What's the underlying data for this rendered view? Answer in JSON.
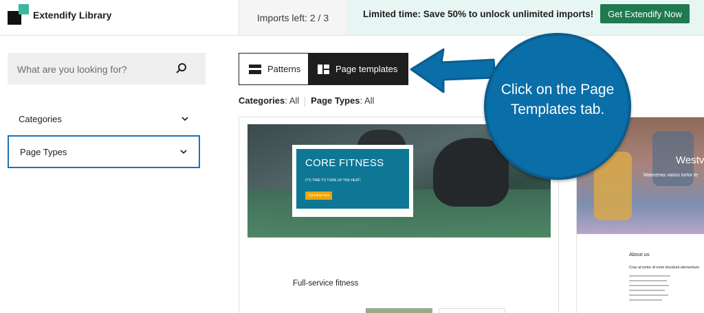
{
  "header": {
    "brand": "Extendify Library",
    "imports_left": "Imports left: 2 / 3",
    "promo": "Limited time: Save 50% to unlock unlimited imports!",
    "cta": "Get Extendify Now"
  },
  "sidebar": {
    "search_placeholder": "What are you looking for?",
    "filters": [
      {
        "label": "Categories"
      },
      {
        "label": "Page Types"
      }
    ]
  },
  "tabs": {
    "patterns": "Patterns",
    "page_templates": "Page templates"
  },
  "filter_summary": {
    "categories_label": "Categories",
    "categories_value": ": All",
    "page_types_label": "Page Types",
    "page_types_value": ": All"
  },
  "cards": [
    {
      "hero_title": "CORE FITNESS",
      "hero_subtitle": "IT'S TIME TO TURN UP THE HEAT!",
      "hero_button": "Schedule now",
      "text": "Full-service fitness"
    },
    {
      "hero_title": "Westv",
      "hero_subtitle": "Maecenas varius tortor te",
      "about_title": "About us",
      "about_subtitle": "Cras at tortor id enim tincidunt elementum"
    }
  ],
  "callout": {
    "text": "Click on the Page\nTemplates tab."
  },
  "colors": {
    "accent_green": "#1f7a4f",
    "promo_bg": "#e8f6f3",
    "callout_blue": "#0a6fa8",
    "focus_border": "#1a73b8"
  }
}
